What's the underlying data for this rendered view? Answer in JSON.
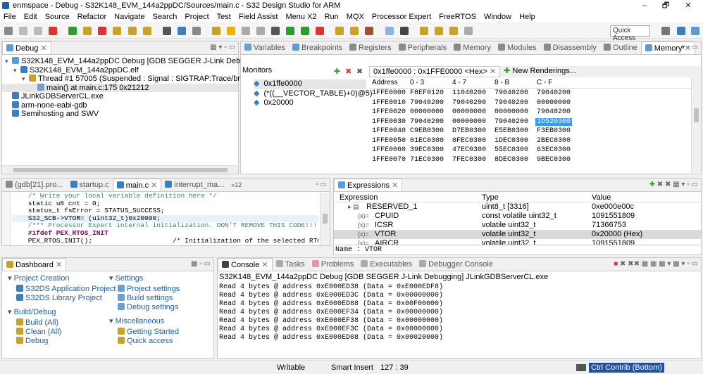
{
  "window": {
    "title": "enmspace - Debug - S32K148_EVM_144a2ppDC/Sources/main.c - S32 Design Studio for ARM",
    "minimize": "–",
    "maximize": "🗗",
    "close": "✕"
  },
  "menu": [
    "File",
    "Edit",
    "Source",
    "Refactor",
    "Navigate",
    "Search",
    "Project",
    "Test",
    "Field Assist",
    "Menu X2",
    "Run",
    "MQX",
    "Processor Expert",
    "FreeRTOS",
    "Window",
    "Help"
  ],
  "toolbar": {
    "quick_access": "Quick Access"
  },
  "debug": {
    "tab": "Debug",
    "tree": [
      {
        "indent": 1,
        "label": "S32K148_EVM_144a2ppDC Debug [GDB SEGGER J-Link Debugging]",
        "icon": "launch-icon"
      },
      {
        "indent": 2,
        "label": "S32K148_EVM_144a2ppDC.elf",
        "icon": "process-icon"
      },
      {
        "indent": 3,
        "label": "Thread #1 57005 (Suspended : Signal : SIGTRAP:Trace/breakpoint",
        "icon": "thread-icon"
      },
      {
        "indent": 4,
        "label": "main() at main.c:175 0x21212",
        "icon": "frame-icon"
      },
      {
        "indent": 1,
        "label": "JLinkGDBServerCL.exe",
        "icon": "exe-icon"
      },
      {
        "indent": 1,
        "label": "arm-none-eabi-gdb",
        "icon": "exe-icon"
      },
      {
        "indent": 1,
        "label": "Semihosting and SWV",
        "icon": "exe-icon"
      }
    ]
  },
  "top_tabs": [
    "Variables",
    "Breakpoints",
    "Registers",
    "Peripherals",
    "Memory",
    "Modules",
    "Disassembly",
    "Outline"
  ],
  "memory": {
    "tab": "Memory",
    "monitors_label": "Monitors",
    "monitors": [
      "0x1ffe0000",
      "(*((__VECTOR_TABLE)+0)@5)",
      "0x20000"
    ],
    "rendering_tab": "0x1ffe0000 : 0x1FFE0000 <Hex>",
    "new_rendering": "New Renderings...",
    "headers": [
      "Address",
      "0 - 3",
      "4 - 7",
      "8 - B",
      "C - F"
    ],
    "rows": [
      [
        "1FFE0000",
        "F8EF0120",
        "11040200",
        "79040200",
        "79040200"
      ],
      [
        "1FFE0010",
        "79040200",
        "79040200",
        "79040200",
        "00000000"
      ],
      [
        "1FFE0020",
        "00000000",
        "00000000",
        "00000000",
        "79040200"
      ],
      [
        "1FFE0030",
        "79040200",
        "00000000",
        "79040200",
        "1D520300"
      ],
      [
        "1FFE0040",
        "C9EB0300",
        "D7EB0300",
        "E5EB0300",
        "F3EB0300"
      ],
      [
        "1FFE0050",
        "01EC0300",
        "0FEC0300",
        "1DEC0300",
        "2BEC0300"
      ],
      [
        "1FFE0060",
        "39EC0300",
        "47EC0300",
        "55EC0300",
        "63EC0300"
      ],
      [
        "1FFE0070",
        "71EC0300",
        "7FEC0300",
        "8DEC0300",
        "9BEC0300"
      ]
    ],
    "selected_cell": "1D520300"
  },
  "editor": {
    "tabs": [
      "(gdb[21].pro...",
      "startup.c",
      "main.c",
      "interrupt_ma..."
    ],
    "overflow": "»12",
    "lines": [
      {
        "text": "    /* Write your local variable definition here */",
        "style": "comment"
      },
      {
        "text": "    static u8 cnt = 0;",
        "style": "code"
      },
      {
        "text": "    status_t fsError = STATUS_SUCCESS;",
        "style": "code"
      },
      {
        "text": "    S32_SCB->VTOR= (uint32_t)0x20000;",
        "style": "code"
      },
      {
        "text": "    /*** Processor Expert internal initialization. DON'T REMOVE THIS CODE!!! ***/",
        "style": "comment"
      },
      {
        "text": "    #ifdef PEX_RTOS_INIT",
        "style": "directive"
      },
      {
        "text": "    PEX_RTOS_INIT();                    /* Initialization of the selected RTOS. Mac",
        "style": "code"
      }
    ]
  },
  "expressions": {
    "tab": "Expressions",
    "headers": [
      "Expression",
      "Type",
      "Value"
    ],
    "rows": [
      {
        "expr": "RESERVED_1",
        "type": "uint8_t [3316]",
        "value": "0xe000e00c"
      },
      {
        "expr": "CPUID",
        "type": "const volatile uint32_t",
        "value": "1091551809"
      },
      {
        "expr": "ICSR",
        "type": "volatile uint32_t",
        "value": "71366753"
      },
      {
        "expr": "VTOR",
        "type": "volatile uint32_t",
        "value": "0x20000 (Hex)"
      },
      {
        "expr": "AIRCR",
        "type": "volatile uint32_t",
        "value": "1091551809"
      }
    ],
    "name_label": "Name : VTOR"
  },
  "dashboard": {
    "tab": "Dashboard",
    "project_creation": {
      "title": "Project Creation",
      "items": [
        "S32DS Application Project",
        "S32DS Library Project"
      ]
    },
    "settings": {
      "title": "Settings",
      "items": [
        "Project settings",
        "Build settings",
        "Debug settings"
      ]
    },
    "build_debug": {
      "title": "Build/Debug",
      "items": [
        "Build  (All)",
        "Clean  (All)",
        "Debug"
      ]
    },
    "misc": {
      "title": "Miscellaneous",
      "items": [
        "Getting Started",
        "Quick access"
      ]
    }
  },
  "console": {
    "tabs": [
      "Console",
      "Tasks",
      "Problems",
      "Executables",
      "Debugger Console"
    ],
    "header": "S32K148_EVM_144a2ppDC Debug [GDB SEGGER J-Link Debugging] JLinkGDBServerCL.exe",
    "lines": [
      "Read 4 bytes @ address 0xE000ED38 (Data = 0xE000EDF8)",
      "Read 4 bytes @ address 0xE000ED3C (Data = 0x00000000)",
      "Read 4 bytes @ address 0xE000ED88 (Data = 0x00F00000)",
      "Read 4 bytes @ address 0xE000EF34 (Data = 0x00000000)",
      "Read 4 bytes @ address 0xE000EF38 (Data = 0x00000000)",
      "Read 4 bytes @ address 0xE000EF3C (Data = 0x00000000)",
      "Read 4 bytes @ address 0xE000ED08 (Data = 0x00020000)"
    ]
  },
  "statusbar": {
    "mode": "Writable",
    "insert": "Smart Insert",
    "position": "127 : 39",
    "hint": "Ctrl Contrib (Bottom)"
  },
  "colors": {
    "accent": "#1f5fa8",
    "selection": "#3399ff",
    "comment": "#3f7f5f",
    "keyword": "#7f0055"
  }
}
